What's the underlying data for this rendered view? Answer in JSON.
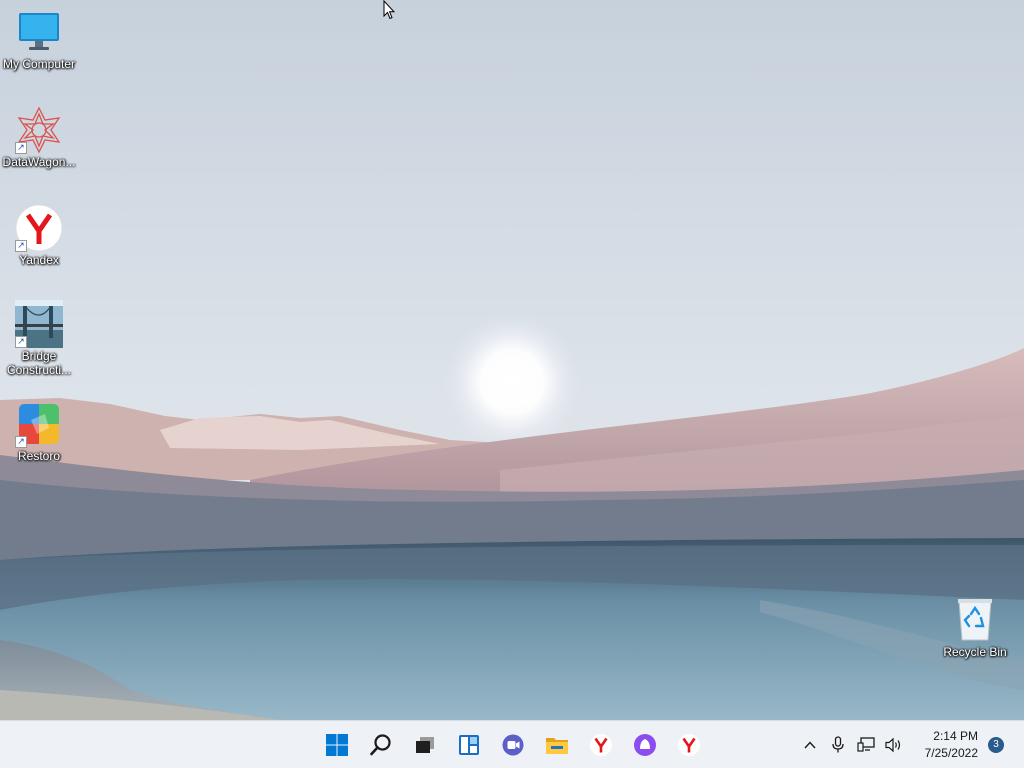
{
  "desktop": {
    "icons": [
      {
        "label": "My Computer"
      },
      {
        "label": "DataWagon..."
      },
      {
        "label": "Yandex"
      },
      {
        "label": "Bridge Constructi..."
      },
      {
        "label": "Restoro"
      },
      {
        "label": "Recycle Bin"
      }
    ]
  },
  "taskbar": {
    "pinned": [
      {
        "name": "start",
        "icon": "windows-logo-icon"
      },
      {
        "name": "search",
        "icon": "search-icon"
      },
      {
        "name": "task-view",
        "icon": "task-view-icon"
      },
      {
        "name": "widgets",
        "icon": "widgets-icon"
      },
      {
        "name": "chat",
        "icon": "teams-chat-icon"
      },
      {
        "name": "file-explorer",
        "icon": "folder-icon"
      },
      {
        "name": "yandex-browser",
        "icon": "yandex-icon"
      },
      {
        "name": "alice",
        "icon": "alice-assistant-icon"
      },
      {
        "name": "yandex-browser-2",
        "icon": "yandex-icon"
      }
    ],
    "tray": {
      "time": "2:14 PM",
      "date": "7/25/2022",
      "notification_count": "3"
    }
  },
  "colors": {
    "accent": "#0078d4",
    "yandex_red": "#e4161c",
    "taskbar_bg": "#eef1f5"
  }
}
